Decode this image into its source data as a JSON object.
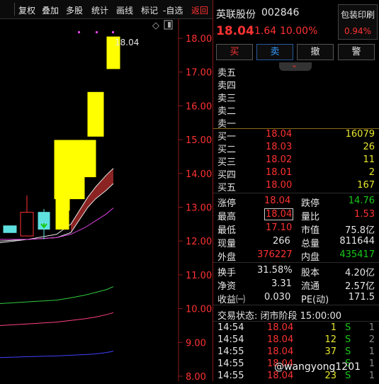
{
  "toolbar": {
    "items": [
      "复权",
      "叠加",
      "多股",
      "统计",
      "画线",
      "标记",
      "-自选",
      "返回"
    ]
  },
  "chart": {
    "price_labels": [
      "18.00",
      "17.00",
      "16.00",
      "15.00",
      "14.00",
      "13.00",
      "12.00",
      "11.00",
      "10.00",
      "9.00",
      "8.00"
    ],
    "last_price_label": "18.04"
  },
  "chart_data": {
    "type": "candlestick",
    "ylim": [
      8.0,
      18.5
    ],
    "candles": [
      {
        "open": 12.45,
        "close": 12.25,
        "high": 12.45,
        "low": 12.25
      },
      {
        "open": 12.15,
        "close": 12.85,
        "high": 13.35,
        "low": 12.15
      },
      {
        "open": 12.35,
        "close": 12.85,
        "high": 12.95,
        "low": 12.05
      },
      {
        "open": 12.35,
        "close": 13.55,
        "high": 13.55,
        "low": 12.35
      },
      {
        "open": 13.25,
        "close": 14.98,
        "high": 14.98,
        "low": 12.9
      },
      {
        "open": 13.9,
        "close": 14.98,
        "high": 14.98,
        "low": 13.9
      },
      {
        "open": 15.1,
        "close": 16.4,
        "high": 16.4,
        "low": 15.1
      },
      {
        "open": 17.1,
        "close": 18.04,
        "high": 18.04,
        "low": 17.1
      }
    ],
    "lines": [
      {
        "color": "#e6e6e6",
        "values": [
          12.0,
          12.05,
          12.2,
          12.5,
          13.3,
          13.6,
          13.95,
          14.15
        ]
      },
      {
        "color": "#e6e6e6",
        "values": [
          11.95,
          12.05,
          12.1,
          12.25,
          13.0,
          13.25,
          13.5,
          13.7
        ]
      },
      {
        "color": "#e040e0",
        "values": [
          12.05,
          12.05,
          12.1,
          12.2,
          12.4,
          12.6,
          12.8,
          12.98
        ]
      },
      {
        "color": "#2ecc40",
        "values": [
          10.15,
          10.2,
          10.25,
          10.32,
          10.4,
          10.48,
          10.56,
          10.65
        ]
      },
      {
        "color": "#ff4080",
        "values": [
          9.5,
          9.55,
          9.6,
          9.65,
          9.7,
          9.75,
          9.82,
          9.88
        ]
      },
      {
        "color": "#4040ff",
        "values": [
          8.55,
          8.58,
          8.6,
          8.62,
          8.64,
          8.66,
          8.7,
          8.74
        ]
      }
    ]
  },
  "header": {
    "name": "英联股份",
    "code": "002846",
    "tag": "包装印刷",
    "price": "18.04",
    "change": "1.64",
    "pct": "10.00%",
    "tag_pct": "0.94%"
  },
  "buttons": [
    "买",
    "卖",
    "撤",
    "警"
  ],
  "sell_labels": [
    "卖五",
    "卖四",
    "卖三",
    "卖二",
    "卖一"
  ],
  "buy_rows": [
    {
      "label": "买一",
      "price": "18.04",
      "vol": "16079"
    },
    {
      "label": "买二",
      "price": "18.03",
      "vol": "26"
    },
    {
      "label": "买三",
      "price": "18.02",
      "vol": "11"
    },
    {
      "label": "买四",
      "price": "18.01",
      "vol": "2"
    },
    {
      "label": "买五",
      "price": "18.00",
      "vol": "167"
    }
  ],
  "stats": {
    "zhangting_l": "涨停",
    "zhangting_v": "18.04",
    "dieting_l": "跌停",
    "dieting_v": "14.76",
    "zuigao_l": "最高",
    "zuigao_v": "18.04",
    "liangbi_l": "量比",
    "liangbi_v": "1.53",
    "zuidi_l": "最低",
    "zuidi_v": "17.10",
    "shizhi_l": "市值",
    "shizhi_v": "75.8亿",
    "xianliang_l": "现量",
    "xianliang_v": "266",
    "zongliang_l": "总量",
    "zongliang_v": "811644",
    "waipan_l": "外盘",
    "waipan_v": "376227",
    "neipan_l": "内盘",
    "neipan_v": "435417"
  },
  "stats2": {
    "huanshou_l": "换手",
    "huanshou_v": "31.58%",
    "guben_l": "股本",
    "guben_v": "4.20亿",
    "jingzi_l": "净资",
    "jingzi_v": "3.31",
    "liutong_l": "流通",
    "liutong_v": "2.57亿",
    "shouyi_l": "收益㈠",
    "shouyi_v": "0.030",
    "pe_l": "PE(动)",
    "pe_v": "171.5"
  },
  "status": "交易状态: 闭市阶段 15:00:00",
  "ticks": [
    {
      "time": "14:54",
      "price": "18.04",
      "vol": "1",
      "side": "S",
      "n": "1"
    },
    {
      "time": "14:54",
      "price": "18.04",
      "vol": "12",
      "side": "S",
      "n": "2"
    },
    {
      "time": "14:55",
      "price": "18.04",
      "vol": "37",
      "side": "S",
      "n": "1"
    },
    {
      "time": "14:55",
      "price": "18.04",
      "vol": "",
      "side": "S",
      "n": "1"
    },
    {
      "time": "14:55",
      "price": "18.04",
      "vol": "23",
      "side": "S",
      "n": "1"
    }
  ],
  "watermark": "@wangyong1201"
}
